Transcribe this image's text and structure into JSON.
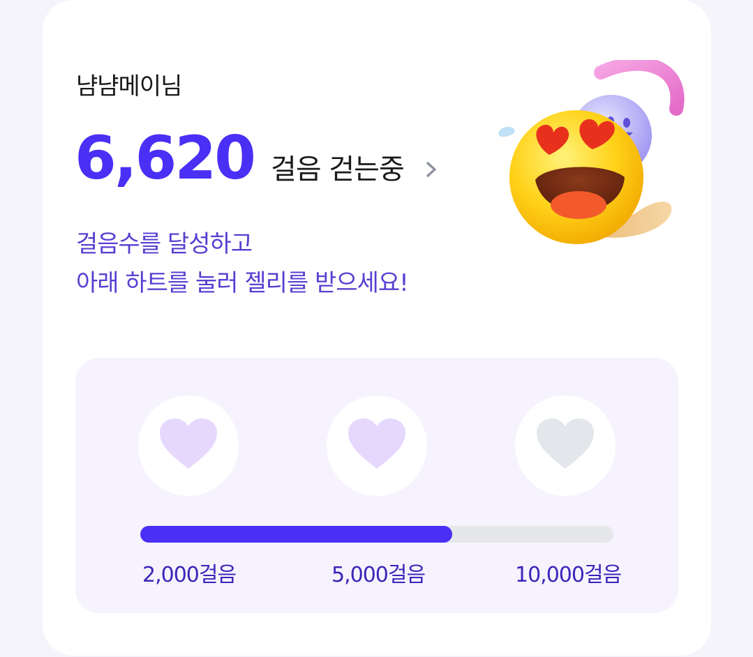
{
  "user": {
    "name": "냠냠메이님"
  },
  "steps": {
    "count": "6,620",
    "suffix": "걸음 걷는중"
  },
  "message": {
    "line1": "걸음수를 달성하고",
    "line2": "아래 하트를 눌러 젤리를 받으세요!"
  },
  "rewards": {
    "progress_fraction": 0.66,
    "milestones": [
      {
        "label": "2,000걸음",
        "heart_state": "achieved"
      },
      {
        "label": "5,000걸음",
        "heart_state": "achieved"
      },
      {
        "label": "10,000걸음",
        "heart_state": "locked"
      }
    ]
  },
  "colors": {
    "accent": "#4a2ff5",
    "message_text": "#5a3fd0",
    "heart_achieved": "#e6d8fd",
    "heart_locked": "#e3e6ea",
    "track": "#e6e7eb",
    "panel_bg": "#f6f3fe"
  },
  "icons": {
    "steps_link": "chevron-right-icon",
    "mascot": "heart-eyes-emoji-mascot",
    "milestone_heart": "heart-icon"
  }
}
